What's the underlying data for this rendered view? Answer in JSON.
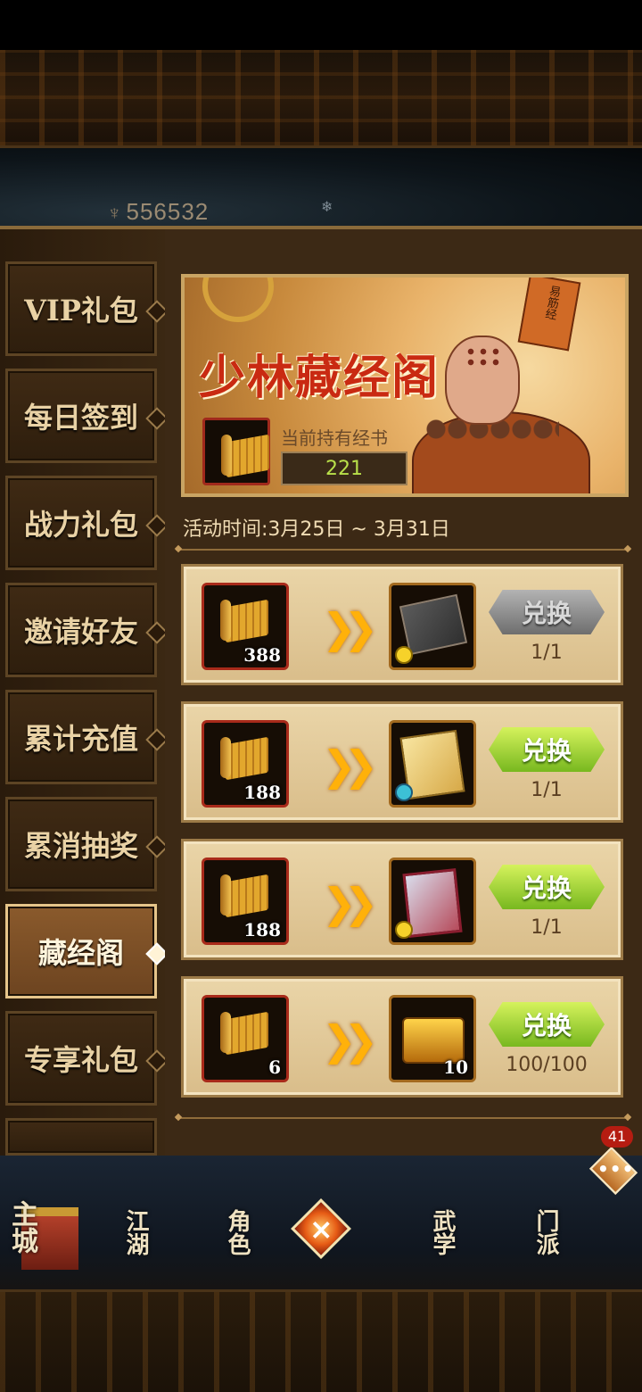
{
  "header": {
    "power_value": "556532"
  },
  "sidebar": {
    "tabs": [
      {
        "label": "VIP礼包",
        "active": false
      },
      {
        "label": "每日签到",
        "active": false
      },
      {
        "label": "战力礼包",
        "active": false
      },
      {
        "label": "邀请好友",
        "active": false
      },
      {
        "label": "累计充值",
        "active": false
      },
      {
        "label": "累消抽奖",
        "active": false
      },
      {
        "label": "藏经阁",
        "active": true
      },
      {
        "label": "专享礼包",
        "active": false
      }
    ]
  },
  "banner": {
    "title": "少林藏经阁",
    "book_text": "易筋经",
    "holding_label": "当前持有经书",
    "holding_value": "221"
  },
  "event_time": "活动时间:3月25日 ~ 3月31日",
  "exchanges": [
    {
      "cost": "388",
      "reward_count": "",
      "button": "兑换",
      "enabled": false,
      "limit": "1/1"
    },
    {
      "cost": "188",
      "reward_count": "",
      "button": "兑换",
      "enabled": true,
      "limit": "1/1"
    },
    {
      "cost": "188",
      "reward_count": "",
      "button": "兑换",
      "enabled": true,
      "limit": "1/1"
    },
    {
      "cost": "6",
      "reward_count": "10",
      "button": "兑换",
      "enabled": true,
      "limit": "100/100"
    }
  ],
  "bottom_nav": {
    "home": "主城",
    "jianghu": "江湖",
    "role": "角色",
    "wuxue": "武学",
    "menpai": "门派",
    "chat_badge": "41"
  },
  "colors": {
    "accent_red": "#c92a12",
    "button_green": "#8cc63f",
    "button_disabled": "#8a8a8a",
    "panel_bg": "#3c2915"
  }
}
